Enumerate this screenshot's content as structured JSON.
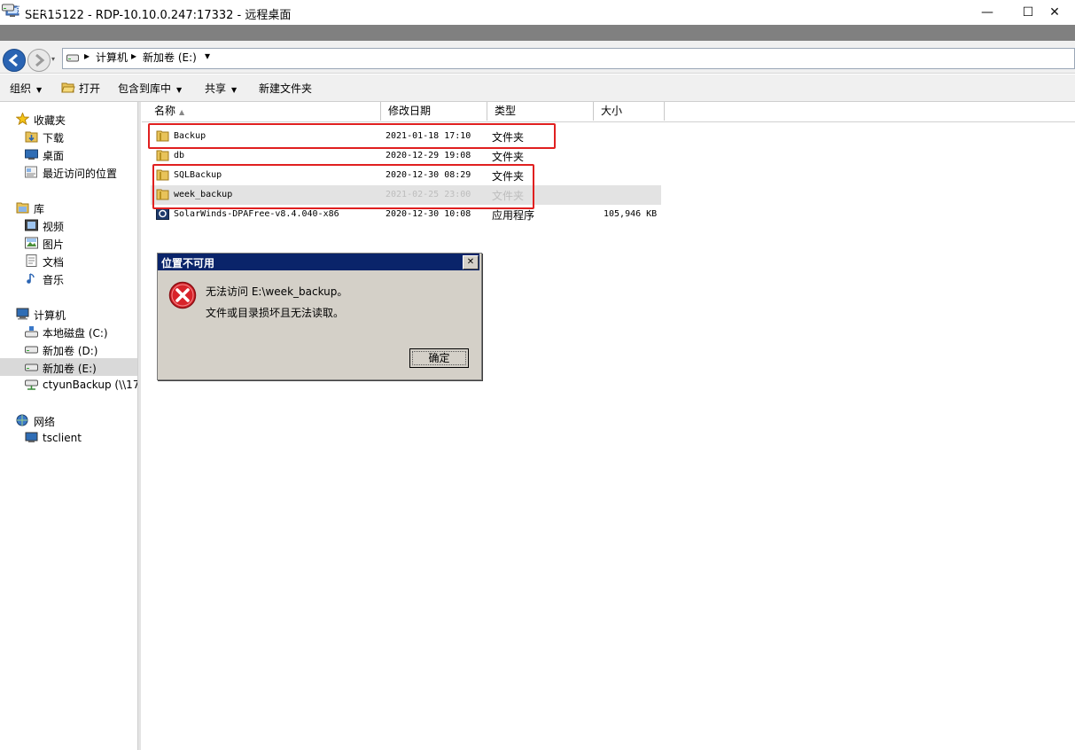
{
  "rdp_window": {
    "title": "SER15122 - RDP-10.10.0.247:17332 - 远程桌面",
    "minimize": "—",
    "maximize": "☐",
    "close": "✕"
  },
  "explorer_window": {
    "title": "新加卷 (E:)"
  },
  "address_bar": {
    "crumb_separator": "▸",
    "crumbs": [
      "计算机",
      "新加卷 (E:)"
    ],
    "dropdown": "▾"
  },
  "command_bar": {
    "organize": "组织",
    "open": "打开",
    "include_in_library": "包含到库中",
    "share": "共享",
    "new_folder": "新建文件夹"
  },
  "nav_pane": {
    "favorites": "收藏夹",
    "downloads": "下载",
    "desktop": "桌面",
    "recent_places": "最近访问的位置",
    "libraries": "库",
    "videos": "视频",
    "pictures": "图片",
    "documents": "文档",
    "music": "音乐",
    "computer": "计算机",
    "local_disk_c": "本地磁盘 (C:)",
    "volume_d": "新加卷 (D:)",
    "volume_e": "新加卷 (E:)",
    "network_share": "ctyunBackup (\\\\172",
    "network": "网络",
    "tsclient": "tsclient"
  },
  "columns": {
    "name": "名称",
    "date_modified": "修改日期",
    "type": "类型",
    "size": "大小"
  },
  "files": [
    {
      "name": "Backup",
      "date": "2021-01-18 17:10",
      "type": "文件夹",
      "size": ""
    },
    {
      "name": "db",
      "date": "2020-12-29 19:08",
      "type": "文件夹",
      "size": ""
    },
    {
      "name": "SQLBackup",
      "date": "2020-12-30 08:29",
      "type": "文件夹",
      "size": ""
    },
    {
      "name": "week_backup",
      "date": "2021-02-25 23:00",
      "type": "文件夹",
      "size": ""
    },
    {
      "name": "SolarWinds-DPAFree-v8.4.040-x86",
      "date": "2020-12-30 10:08",
      "type": "应用程序",
      "size": "105,946 KB"
    }
  ],
  "dialog": {
    "title": "位置不可用",
    "close": "✕",
    "message_line1": "无法访问 E:\\week_backup。",
    "message_line2": "文件或目录损坏且无法读取。",
    "ok_button": "确定"
  },
  "colors": {
    "annotation": "#e02020",
    "dialog_title_bar": "#0a246a",
    "selected_nav": "#d9d9d9"
  }
}
